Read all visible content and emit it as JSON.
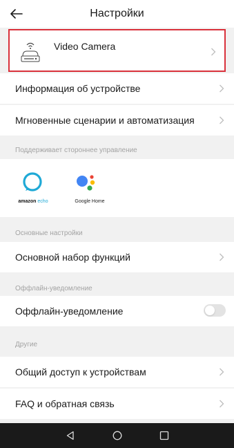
{
  "header": {
    "title": "Настройки",
    "back_icon": "back-arrow-icon"
  },
  "device": {
    "name": "Video Camera",
    "icon": "camera-icon"
  },
  "rows": {
    "device_info": "Информация об устройстве",
    "scenes": "Мгновенные сценарии и автоматизация",
    "basic_functions": "Основной набор функций",
    "offline_notification": "Оффлайн-уведомление",
    "sharing": "Общий доступ к устройствам",
    "faq": "FAQ и обратная связь"
  },
  "sections": {
    "third_party": "Поддерживает стороннее управление",
    "basic": "Основные настройки",
    "offline": "Оффлайн-уведомление",
    "other": "Другие"
  },
  "assistants": [
    {
      "label_brand": "amazon",
      "label_product": "echo",
      "icon": "alexa-icon"
    },
    {
      "label": "Google Home",
      "icon": "google-assistant-icon"
    }
  ],
  "toggles": {
    "offline_notification": false
  },
  "colors": {
    "highlight_border": "#d9303a",
    "alexa": "#1fa9d6",
    "google_blue": "#4285f4",
    "google_red": "#ea4335",
    "google_yellow": "#fbbc05",
    "google_green": "#34a853"
  },
  "navbar": {
    "icons": [
      "nav-back-icon",
      "nav-home-icon",
      "nav-recents-icon"
    ]
  }
}
